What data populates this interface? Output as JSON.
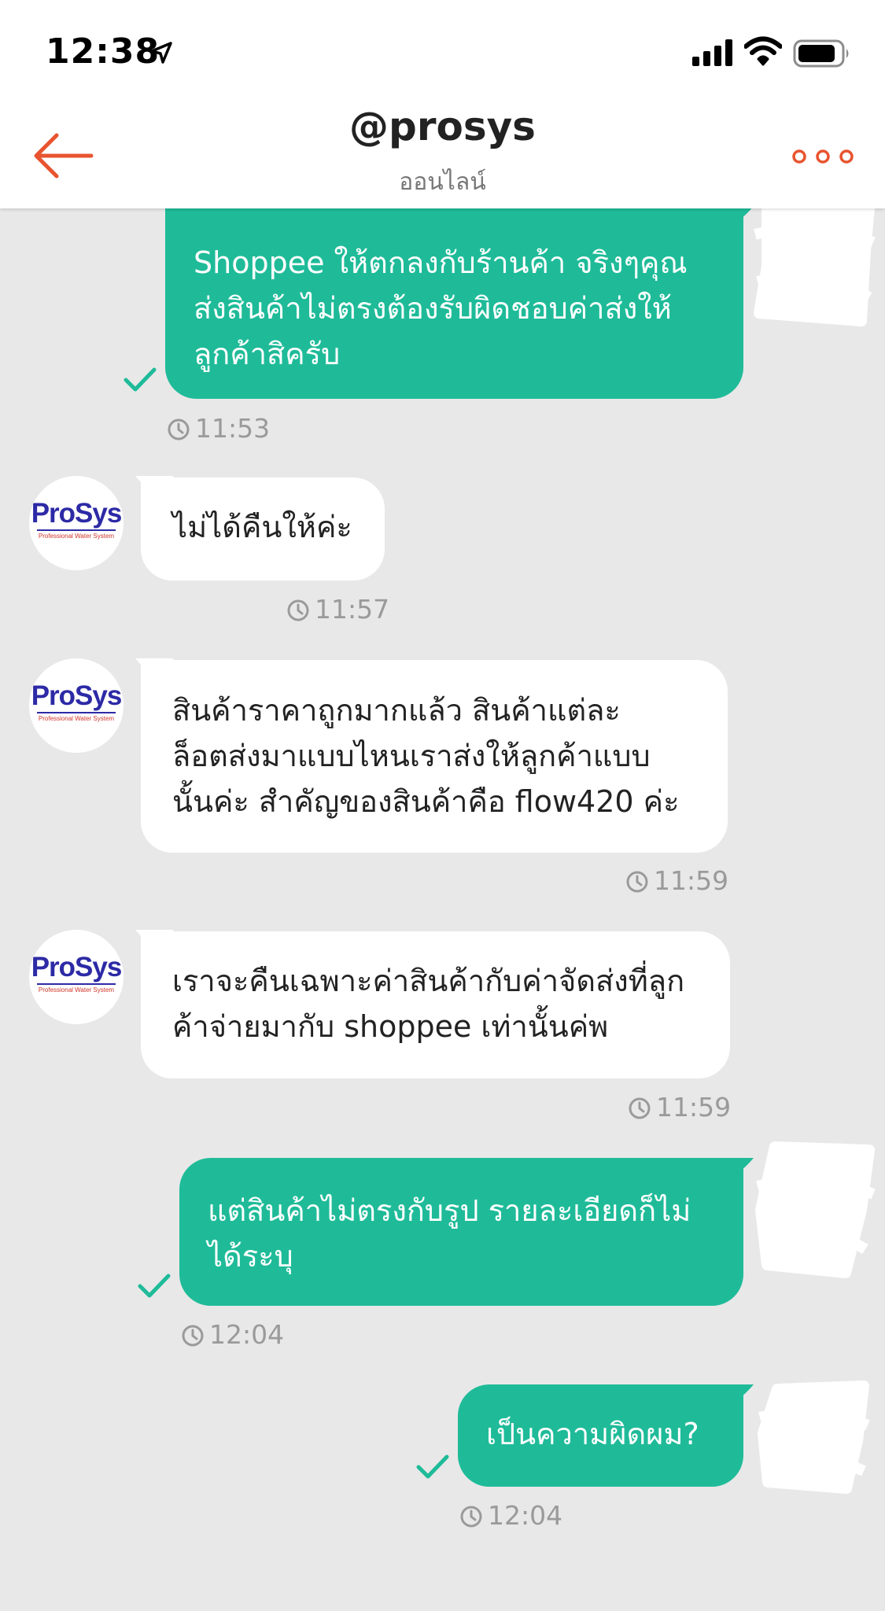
{
  "status_bar": {
    "time": "12:38",
    "icons": [
      "location-arrow-icon",
      "cellular-signal-icon",
      "wifi-icon",
      "battery-icon"
    ]
  },
  "header": {
    "title": "@prosys",
    "subtitle": "ออนไลน์",
    "back_icon": "back-arrow-icon",
    "more_icon": "more-dots-icon",
    "accent_color": "#e8542f"
  },
  "colors": {
    "outgoing_bubble": "#1fbb99",
    "incoming_bubble": "#ffffff",
    "chat_background": "#e8e8e8",
    "timestamp": "#9a9a9a"
  },
  "avatar": {
    "brand": "ProSys",
    "tagline": "Professional Water System"
  },
  "messages": [
    {
      "direction": "outgoing",
      "text": "Shoppee ให้ตกลงกับร้านค้า จริงๆคุณ\nส่งสินค้าไม่ตรงต้องรับผิดชอบค่าส่งให้\nลูกค้าสิครับ",
      "time": "11:53",
      "status_icon": "read-check-icon"
    },
    {
      "direction": "incoming",
      "text": "ไม่ได้คืนให้ค่ะ",
      "time": "11:57"
    },
    {
      "direction": "incoming",
      "text": "สินค้าราคาถูกมากแล้ว สินค้าแต่ละ\nล็อตส่งมาแบบไหนเราส่งให้ลูกค้าแบบ\nนั้นค่ะ สำคัญของสินค้าคือ flow420  ค่ะ",
      "time": "11:59"
    },
    {
      "direction": "incoming",
      "text": "เราจะคืนเฉพาะค่าสินค้ากับค่าจัดส่งที่ลูก\nค้าจ่ายมากับ shoppee เท่านั้นค่พ",
      "time": "11:59"
    },
    {
      "direction": "outgoing",
      "text": "แต่สินค้าไม่ตรงกับรูป รายละเอียดก็ไม่\nได้ระบุ",
      "time": "12:04",
      "status_icon": "read-check-icon"
    },
    {
      "direction": "outgoing",
      "text": "เป็นความผิดผม?",
      "time": "12:04",
      "status_icon": "read-check-icon"
    }
  ]
}
